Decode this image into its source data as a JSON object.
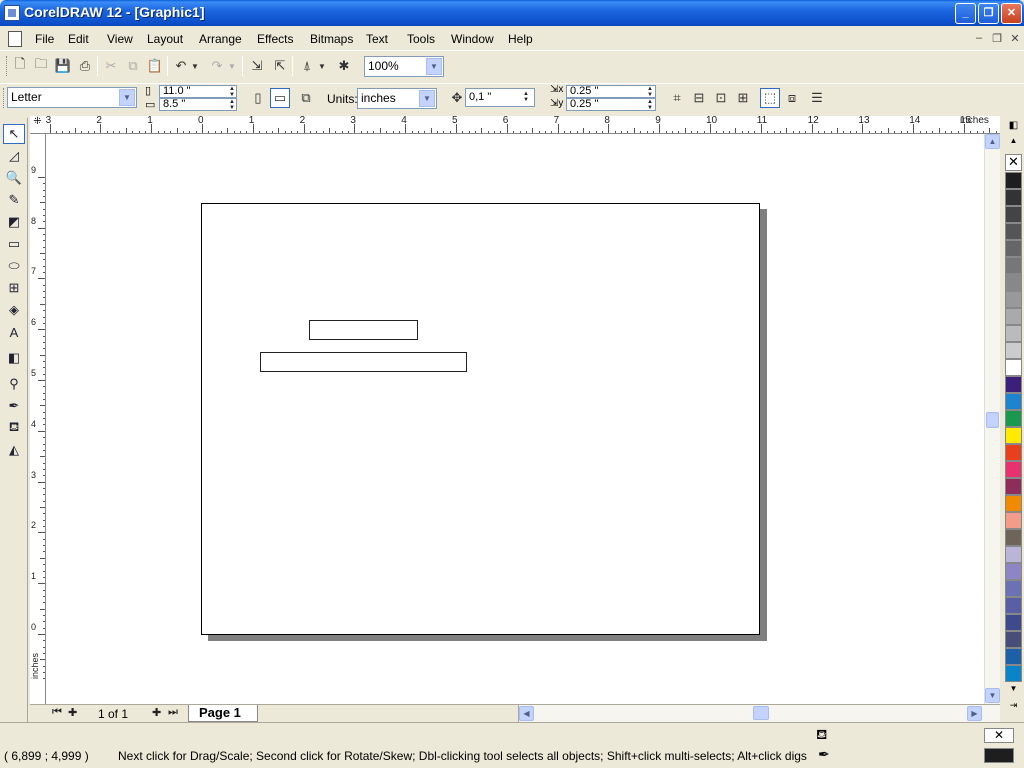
{
  "window": {
    "title": "CorelDRAW 12 - [Graphic1]",
    "controls": {
      "minimize": "_",
      "maximize": "❐",
      "close": "✕"
    }
  },
  "menu": {
    "items": [
      "File",
      "Edit",
      "View",
      "Layout",
      "Arrange",
      "Effects",
      "Bitmaps",
      "Text",
      "Tools",
      "Window",
      "Help"
    ],
    "doc_controls": {
      "minimize": "–",
      "restore": "❐",
      "close": "✕"
    }
  },
  "standard_toolbar": {
    "zoom_value": "100%"
  },
  "property_bar": {
    "paper_size": "Letter",
    "width": "11.0 \"",
    "height": "8.5 \"",
    "units_label": "Units:",
    "units_value": "inches",
    "nudge": "0,1 \"",
    "dup_x": "0.25 \"",
    "dup_y": "0.25 \""
  },
  "rulers": {
    "horizontal_ticks": [
      "3",
      "2",
      "1",
      "0",
      "1",
      "2",
      "3",
      "4",
      "5",
      "6",
      "7",
      "8",
      "9",
      "10",
      "11",
      "12",
      "13",
      "14",
      "15"
    ],
    "horizontal_unit": "inches",
    "vertical_ticks": [
      "9",
      "8",
      "7",
      "6",
      "5",
      "4",
      "3",
      "2",
      "1",
      "0"
    ],
    "vertical_unit": "inches"
  },
  "page_nav": {
    "count": "1 of 1",
    "tab": "Page 1"
  },
  "status": {
    "coords": "( 6,899 ; 4,999 )",
    "message": "Next click for Drag/Scale; Second click for Rotate/Skew; Dbl-clicking tool selects all objects; Shift+click multi-selects; Alt+click digs"
  },
  "palette_colors": [
    "#1e1e1e",
    "#333333",
    "#444444",
    "#555555",
    "#666666",
    "#777777",
    "#888888",
    "#999999",
    "#aaaaaa",
    "#bbbbbb",
    "#cccccc",
    "#ffffff",
    "#3b1f7a",
    "#1e84d0",
    "#1a9850",
    "#ffea00",
    "#e8401c",
    "#e8326e",
    "#8e2d5a",
    "#f08a00",
    "#f49c8c",
    "#6e6459",
    "#b9b4d8",
    "#8e86c4",
    "#6b72b4",
    "#5a5ea4",
    "#3e4a8c",
    "#474e7a",
    "#1e60a8",
    "#0a84c8"
  ],
  "colors": {
    "title_bar": "#0a4fc9",
    "chrome": "#ece9d8",
    "page_shadow": "#808080",
    "fill_indicator": "#1e1e1e"
  }
}
